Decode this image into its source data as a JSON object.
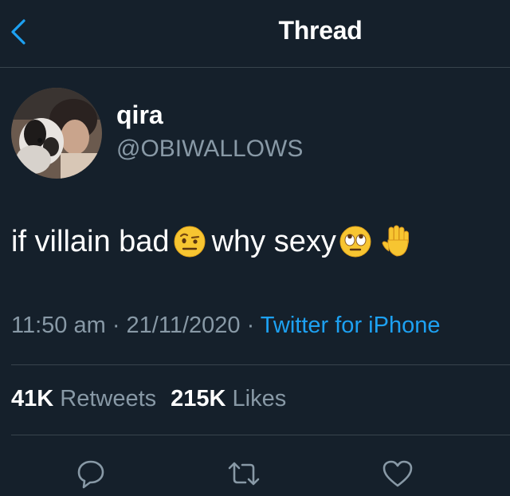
{
  "header": {
    "title": "Thread",
    "back_icon": "chevron-left-icon",
    "accent_color": "#1da1f2"
  },
  "author": {
    "display_name": "qira",
    "handle": "@OBIWALLOWS"
  },
  "tweet": {
    "text_part1": "if villain bad",
    "text_part2": "why sexy",
    "emoji_1": "face-with-raised-eyebrow",
    "emoji_2": "face-with-rolling-eyes",
    "emoji_3": "raised-hand"
  },
  "meta": {
    "time": "11:50 am",
    "separator": " · ",
    "date": "21/11/2020",
    "source": "Twitter for iPhone"
  },
  "stats": {
    "retweets_count": "41K",
    "retweets_label": "Retweets",
    "likes_count": "215K",
    "likes_label": "Likes"
  },
  "actions": {
    "reply_icon": "reply-icon",
    "retweet_icon": "retweet-icon",
    "like_icon": "heart-icon"
  },
  "colors": {
    "background": "#15202b",
    "secondary_text": "#8899a6",
    "divider": "#38444d"
  }
}
